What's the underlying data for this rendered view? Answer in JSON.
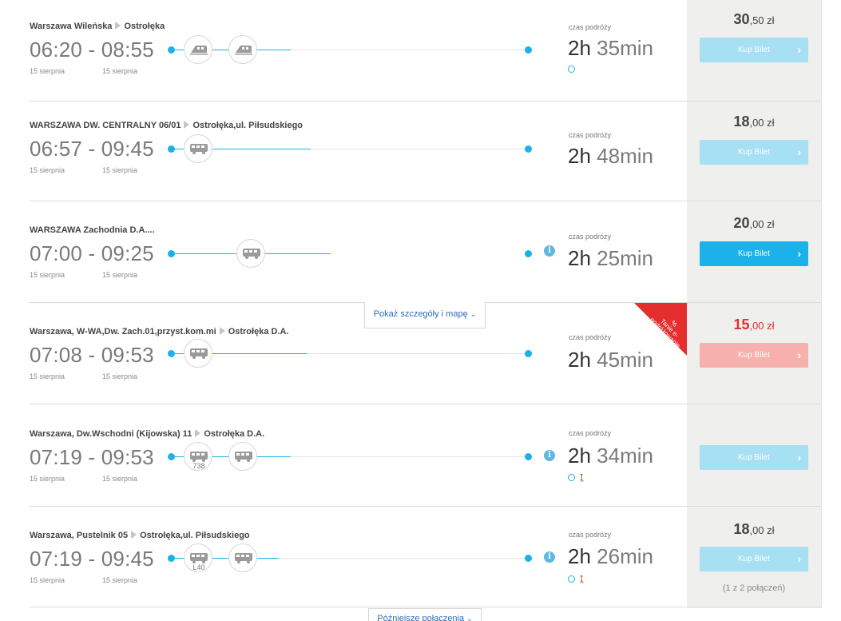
{
  "labels": {
    "czas": "czas podróży",
    "details": "Pokaż szczegóły i mapę",
    "later": "Późniejsze połączenia",
    "promo": "Tanie e-podróżowanie",
    "promo_pct": "%",
    "chevron": "›",
    "info": "i"
  },
  "connections": [
    {
      "from": "Warszawa Wileńska",
      "to": "Ostrołęka",
      "times": "06:20 - 08:55",
      "date_dep": "15 sierpnia",
      "date_arr": "15 sierpnia",
      "dur_h": "2h",
      "dur_m": "35min",
      "price_main": "30",
      "price_rest": ",50 zł",
      "buy": "Kup Bilet",
      "vehicles": [
        "train-icon",
        "train-icon"
      ],
      "vehicle_numbers": [
        "",
        ""
      ]
    },
    {
      "from": "WARSZAWA DW. CENTRALNY 06/01",
      "to": "Ostrołęka,ul. Piłsudskiego",
      "times": "06:57 - 09:45",
      "date_dep": "15 sierpnia",
      "date_arr": "15 sierpnia",
      "dur_h": "2h",
      "dur_m": "48min",
      "price_main": "18",
      "price_rest": ",00 zł",
      "buy": "Kup Bilet",
      "vehicles": [
        "bus-icon"
      ],
      "vehicle_numbers": [
        ""
      ]
    },
    {
      "from": "WARSZAWA Zachodnia D.A....",
      "to": "",
      "times": "07:00 - 09:25",
      "date_dep": "15 sierpnia",
      "date_arr": "15 sierpnia",
      "dur_h": "2h",
      "dur_m": "25min",
      "price_main": "20",
      "price_rest": ",00 zł",
      "buy": "Kup Bilet",
      "vehicles": [
        "bus-icon"
      ],
      "vehicle_numbers": [
        ""
      ]
    },
    {
      "from": "Warszawa, W-WA,Dw. Zach.01,przyst.kom.mi",
      "to": "Ostrołęka D.A.",
      "times": "07:08 - 09:53",
      "date_dep": "15 sierpnia",
      "date_arr": "15 sierpnia",
      "dur_h": "2h",
      "dur_m": "45min",
      "price_main": "15",
      "price_rest": ",00 zł",
      "buy": "Kup Bilet",
      "vehicles": [
        "bus-icon"
      ],
      "vehicle_numbers": [
        ""
      ]
    },
    {
      "from": "Warszawa, Dw.Wschodni (Kijowska) 11",
      "to": "Ostrołęka D.A.",
      "times": "07:19 - 09:53",
      "date_dep": "15 sierpnia",
      "date_arr": "15 sierpnia",
      "dur_h": "2h",
      "dur_m": "34min",
      "price_main": "",
      "price_rest": "",
      "buy": "Kup Bilet",
      "vehicles": [
        "bus-icon",
        "bus-icon"
      ],
      "vehicle_numbers": [
        "738",
        ""
      ]
    },
    {
      "from": "Warszawa, Pustelnik 05",
      "to": "Ostrołęka,ul. Piłsudskiego",
      "times": "07:19 - 09:45",
      "date_dep": "15 sierpnia",
      "date_arr": "15 sierpnia",
      "dur_h": "2h",
      "dur_m": "26min",
      "price_main": "18",
      "price_rest": ",00 zł",
      "buy": "Kup Bilet",
      "vehicles": [
        "bus-icon",
        "bus-icon"
      ],
      "vehicle_numbers": [
        "L40",
        ""
      ],
      "note": "(1 z 2 połączeń)"
    }
  ],
  "colors": {
    "accent": "#1ab2e8",
    "accent_light": "#a7dff3",
    "promo": "#e52e2e",
    "promo_light": "#f6b1ad"
  }
}
